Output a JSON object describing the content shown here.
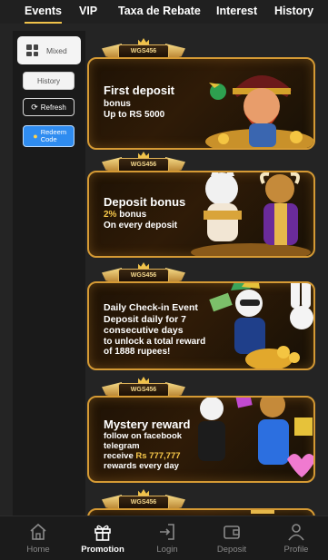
{
  "tabs": [
    {
      "label": "Events",
      "active": true
    },
    {
      "label": "VIP",
      "active": false
    },
    {
      "label": "Taxa de Rebate",
      "active": false
    },
    {
      "label": "Interest",
      "active": false
    },
    {
      "label": "History",
      "active": false
    }
  ],
  "sidebar": {
    "mixed_label": "Mixed",
    "history_label": "History",
    "refresh_label": "Refresh",
    "redeem_label": "Redeem Code"
  },
  "brand_badge": "WGS456",
  "promos": [
    {
      "title": "First deposit",
      "line1": "bonus",
      "line2": "Up to RS 5000",
      "art": "pirate-character-icon"
    },
    {
      "title": "Deposit bonus",
      "line1_highlight": "2%",
      "line1": " bonus",
      "line2": "On every deposit",
      "art": "cat-and-bull-characters-icon"
    },
    {
      "title": "Daily Check-in Event",
      "line1": "Deposit daily for 7",
      "line2": "consecutive days",
      "line3": "to unlock a total reward",
      "line4": "of 1888 rupees!",
      "art": "rabbit-character-icon"
    },
    {
      "title": "Mystery reward",
      "line1": "follow on facebook",
      "line2": "telegram",
      "line3_prefix": "receive ",
      "line3_highlight": "Rs 777,777",
      "line4": "rewards every day",
      "art": "cat-and-bull-gift-icon"
    }
  ],
  "nav": [
    {
      "label": "Home",
      "icon": "home-icon",
      "active": false
    },
    {
      "label": "Promotion",
      "icon": "gift-icon",
      "active": true
    },
    {
      "label": "Login",
      "icon": "login-icon",
      "active": false
    },
    {
      "label": "Deposit",
      "icon": "wallet-icon",
      "active": false
    },
    {
      "label": "Profile",
      "icon": "person-icon",
      "active": false
    }
  ],
  "colors": {
    "accent": "#f0c24a",
    "card_border": "#d59a34",
    "redeem": "#2f8cf0"
  }
}
